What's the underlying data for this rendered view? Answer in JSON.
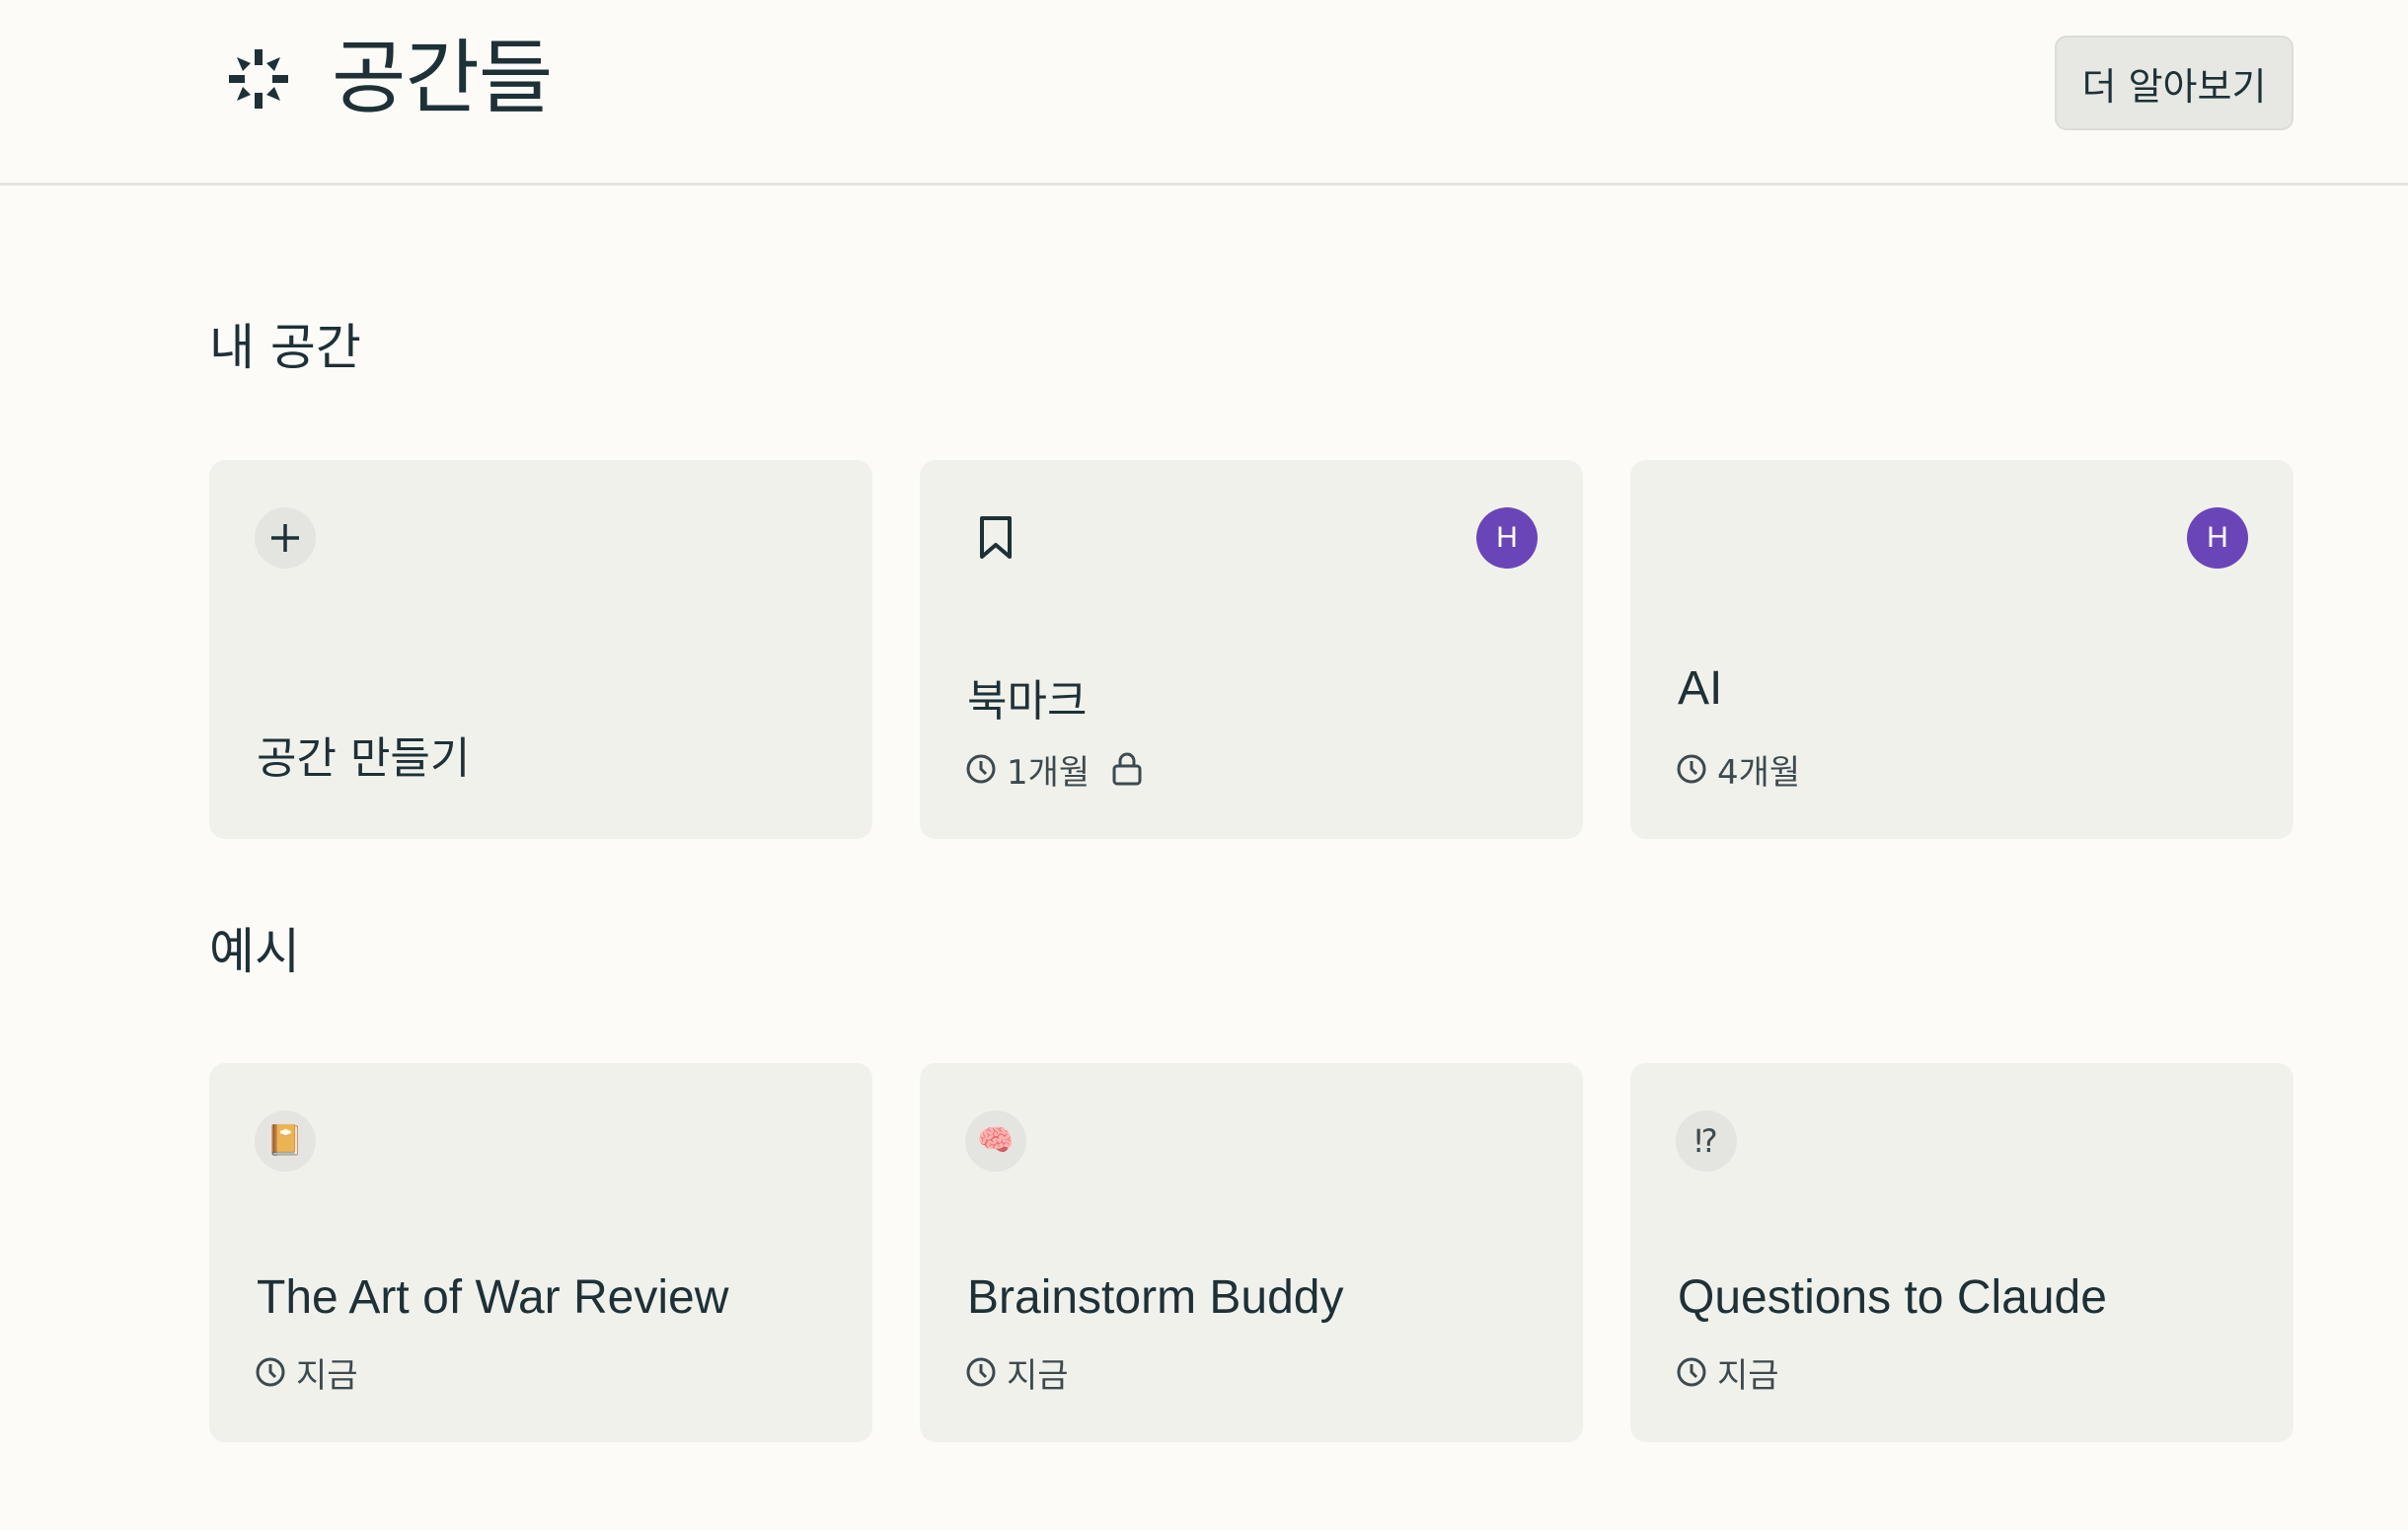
{
  "header": {
    "title": "공간들",
    "learn_more_label": "더 알아보기",
    "logo_icon": "sparkle-diamond-icon"
  },
  "my_spaces": {
    "title": "내 공간",
    "create_card": {
      "label": "공간 만들기",
      "icon": "plus-icon"
    },
    "cards": [
      {
        "title": "북마크",
        "time": "1개월",
        "avatar": "H",
        "icon": "bookmark-icon",
        "locked": true
      },
      {
        "title": "AI",
        "time": "4개월",
        "avatar": "H"
      }
    ]
  },
  "examples": {
    "title": "예시",
    "cards": [
      {
        "title": "The Art of War Review",
        "time": "지금",
        "icon": "book-emoji",
        "emoji": "📔"
      },
      {
        "title": "Brainstorm Buddy",
        "time": "지금",
        "icon": "brain-emoji",
        "emoji": "🧠"
      },
      {
        "title": "Questions to Claude",
        "time": "지금",
        "icon": "interrobang-icon",
        "emoji": "⁉"
      }
    ]
  },
  "colors": {
    "background": "#fcfbf8",
    "card": "#f1f1ec",
    "text": "#1d3137",
    "avatar": "#6a45b8"
  }
}
